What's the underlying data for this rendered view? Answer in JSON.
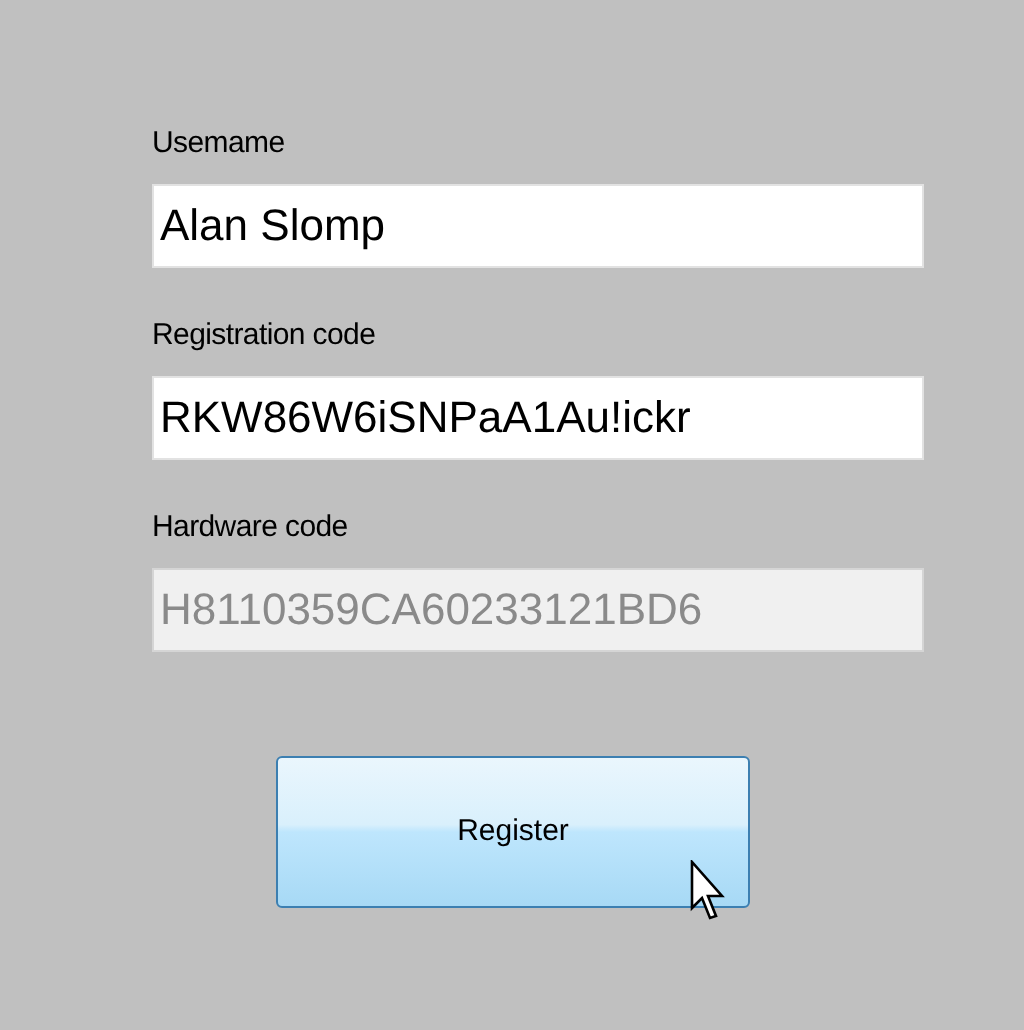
{
  "fields": [
    {
      "label": "Usemame",
      "value": "Alan Slomp",
      "disabled": false
    },
    {
      "label": "Registration code",
      "value": "RKW86W6iSNPaA1Au!ickr",
      "disabled": false
    },
    {
      "label": "Hardware code",
      "value": "H8110359CA60233121BD6",
      "disabled": true
    }
  ],
  "button": {
    "label": "Register",
    "hovered": true
  }
}
